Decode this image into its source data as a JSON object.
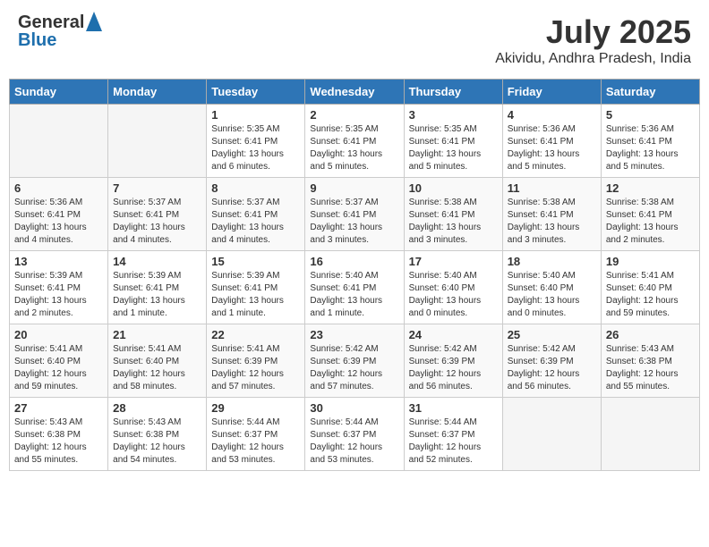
{
  "header": {
    "logo_general": "General",
    "logo_blue": "Blue",
    "month": "July 2025",
    "location": "Akividu, Andhra Pradesh, India"
  },
  "calendar": {
    "days_of_week": [
      "Sunday",
      "Monday",
      "Tuesday",
      "Wednesday",
      "Thursday",
      "Friday",
      "Saturday"
    ],
    "weeks": [
      [
        {
          "day": "",
          "info": ""
        },
        {
          "day": "",
          "info": ""
        },
        {
          "day": "1",
          "info": "Sunrise: 5:35 AM\nSunset: 6:41 PM\nDaylight: 13 hours and 6 minutes."
        },
        {
          "day": "2",
          "info": "Sunrise: 5:35 AM\nSunset: 6:41 PM\nDaylight: 13 hours and 5 minutes."
        },
        {
          "day": "3",
          "info": "Sunrise: 5:35 AM\nSunset: 6:41 PM\nDaylight: 13 hours and 5 minutes."
        },
        {
          "day": "4",
          "info": "Sunrise: 5:36 AM\nSunset: 6:41 PM\nDaylight: 13 hours and 5 minutes."
        },
        {
          "day": "5",
          "info": "Sunrise: 5:36 AM\nSunset: 6:41 PM\nDaylight: 13 hours and 5 minutes."
        }
      ],
      [
        {
          "day": "6",
          "info": "Sunrise: 5:36 AM\nSunset: 6:41 PM\nDaylight: 13 hours and 4 minutes."
        },
        {
          "day": "7",
          "info": "Sunrise: 5:37 AM\nSunset: 6:41 PM\nDaylight: 13 hours and 4 minutes."
        },
        {
          "day": "8",
          "info": "Sunrise: 5:37 AM\nSunset: 6:41 PM\nDaylight: 13 hours and 4 minutes."
        },
        {
          "day": "9",
          "info": "Sunrise: 5:37 AM\nSunset: 6:41 PM\nDaylight: 13 hours and 3 minutes."
        },
        {
          "day": "10",
          "info": "Sunrise: 5:38 AM\nSunset: 6:41 PM\nDaylight: 13 hours and 3 minutes."
        },
        {
          "day": "11",
          "info": "Sunrise: 5:38 AM\nSunset: 6:41 PM\nDaylight: 13 hours and 3 minutes."
        },
        {
          "day": "12",
          "info": "Sunrise: 5:38 AM\nSunset: 6:41 PM\nDaylight: 13 hours and 2 minutes."
        }
      ],
      [
        {
          "day": "13",
          "info": "Sunrise: 5:39 AM\nSunset: 6:41 PM\nDaylight: 13 hours and 2 minutes."
        },
        {
          "day": "14",
          "info": "Sunrise: 5:39 AM\nSunset: 6:41 PM\nDaylight: 13 hours and 1 minute."
        },
        {
          "day": "15",
          "info": "Sunrise: 5:39 AM\nSunset: 6:41 PM\nDaylight: 13 hours and 1 minute."
        },
        {
          "day": "16",
          "info": "Sunrise: 5:40 AM\nSunset: 6:41 PM\nDaylight: 13 hours and 1 minute."
        },
        {
          "day": "17",
          "info": "Sunrise: 5:40 AM\nSunset: 6:40 PM\nDaylight: 13 hours and 0 minutes."
        },
        {
          "day": "18",
          "info": "Sunrise: 5:40 AM\nSunset: 6:40 PM\nDaylight: 13 hours and 0 minutes."
        },
        {
          "day": "19",
          "info": "Sunrise: 5:41 AM\nSunset: 6:40 PM\nDaylight: 12 hours and 59 minutes."
        }
      ],
      [
        {
          "day": "20",
          "info": "Sunrise: 5:41 AM\nSunset: 6:40 PM\nDaylight: 12 hours and 59 minutes."
        },
        {
          "day": "21",
          "info": "Sunrise: 5:41 AM\nSunset: 6:40 PM\nDaylight: 12 hours and 58 minutes."
        },
        {
          "day": "22",
          "info": "Sunrise: 5:41 AM\nSunset: 6:39 PM\nDaylight: 12 hours and 57 minutes."
        },
        {
          "day": "23",
          "info": "Sunrise: 5:42 AM\nSunset: 6:39 PM\nDaylight: 12 hours and 57 minutes."
        },
        {
          "day": "24",
          "info": "Sunrise: 5:42 AM\nSunset: 6:39 PM\nDaylight: 12 hours and 56 minutes."
        },
        {
          "day": "25",
          "info": "Sunrise: 5:42 AM\nSunset: 6:39 PM\nDaylight: 12 hours and 56 minutes."
        },
        {
          "day": "26",
          "info": "Sunrise: 5:43 AM\nSunset: 6:38 PM\nDaylight: 12 hours and 55 minutes."
        }
      ],
      [
        {
          "day": "27",
          "info": "Sunrise: 5:43 AM\nSunset: 6:38 PM\nDaylight: 12 hours and 55 minutes."
        },
        {
          "day": "28",
          "info": "Sunrise: 5:43 AM\nSunset: 6:38 PM\nDaylight: 12 hours and 54 minutes."
        },
        {
          "day": "29",
          "info": "Sunrise: 5:44 AM\nSunset: 6:37 PM\nDaylight: 12 hours and 53 minutes."
        },
        {
          "day": "30",
          "info": "Sunrise: 5:44 AM\nSunset: 6:37 PM\nDaylight: 12 hours and 53 minutes."
        },
        {
          "day": "31",
          "info": "Sunrise: 5:44 AM\nSunset: 6:37 PM\nDaylight: 12 hours and 52 minutes."
        },
        {
          "day": "",
          "info": ""
        },
        {
          "day": "",
          "info": ""
        }
      ]
    ]
  }
}
